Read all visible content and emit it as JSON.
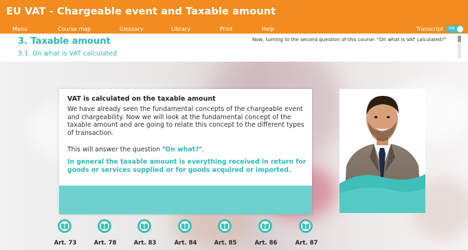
{
  "app": {
    "title": "EU VAT - Chargeable event and Taxable amount",
    "brand_color": "#f28c1e",
    "accent_color": "#2fb9b5"
  },
  "menu": {
    "items": [
      "Menu",
      "Course map",
      "Glossary",
      "Library",
      "Print",
      "Help"
    ],
    "transcript_label": "Transcript",
    "toggle_label": "ON",
    "toggle_state": "on"
  },
  "heading": {
    "section": "3. Taxable amount",
    "subsection": "3.1. On what is VAT calculated"
  },
  "transcript": {
    "text": "Now, turning to the second question of this course: \"On what is VAT calculated?\""
  },
  "card": {
    "title": "VAT is calculated on the taxable amount",
    "paragraph": "We have already seen the fundamental concepts of the chargeable event and chargeability. Now we will look at the fundamental concept of the taxable amount and are going to relate this concept to the different types of transaction.",
    "question_prefix": "This will answer the question \"",
    "question_highlight": "On what?",
    "question_suffix": "\".",
    "highlight": "In general the taxable amount is everything received in return for goods or services supplied or for goods acquired or imported."
  },
  "articles": [
    {
      "label": "Art. 73",
      "icon": "book-icon"
    },
    {
      "label": "Art. 78",
      "icon": "book-icon"
    },
    {
      "label": "Art. 83",
      "icon": "book-icon"
    },
    {
      "label": "Art. 84",
      "icon": "book-icon"
    },
    {
      "label": "Art. 85",
      "icon": "book-icon"
    },
    {
      "label": "Art. 86",
      "icon": "book-icon"
    },
    {
      "label": "Art. 87",
      "icon": "book-icon"
    }
  ]
}
